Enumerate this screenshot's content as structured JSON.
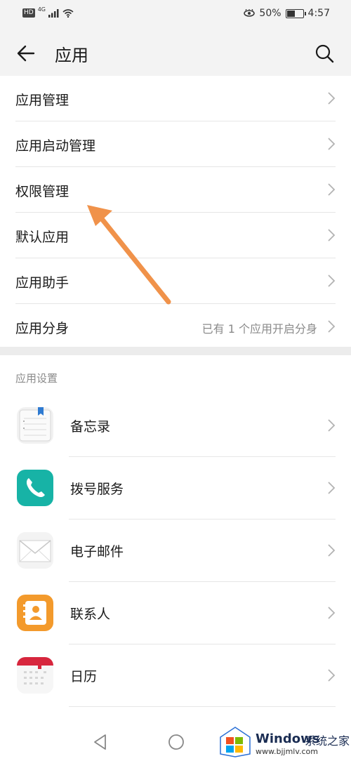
{
  "status_bar": {
    "hd_badge": "HD",
    "network_label": "4G",
    "eye_icon": "eye-comfort-icon",
    "battery_percent": "50%",
    "battery_fraction": 0.5,
    "time": "4:57"
  },
  "header": {
    "title": "应用",
    "back_icon": "back-arrow-icon",
    "search_icon": "search-icon"
  },
  "menu": {
    "items": [
      {
        "label": "应用管理",
        "value": ""
      },
      {
        "label": "应用启动管理",
        "value": ""
      },
      {
        "label": "权限管理",
        "value": ""
      },
      {
        "label": "默认应用",
        "value": ""
      },
      {
        "label": "应用助手",
        "value": ""
      },
      {
        "label": "应用分身",
        "value": "已有 1 个应用开启分身"
      }
    ]
  },
  "app_settings": {
    "section_title": "应用设置",
    "apps": [
      {
        "label": "备忘录",
        "icon": "notepad-icon",
        "color": "#f1f1f1"
      },
      {
        "label": "拨号服务",
        "icon": "phone-icon",
        "color": "#17b3a6"
      },
      {
        "label": "电子邮件",
        "icon": "mail-icon",
        "color": "#f3f3f3"
      },
      {
        "label": "联系人",
        "icon": "contacts-icon",
        "color": "#f39a2c"
      },
      {
        "label": "日历",
        "icon": "calendar-icon",
        "color": "#d7263d"
      }
    ]
  },
  "annotation": {
    "color": "#f0924a"
  },
  "nav_bar": {
    "back_icon": "nav-back-icon",
    "home_icon": "nav-home-icon"
  },
  "watermark": {
    "brand": "Windows",
    "suffix": "系统之家",
    "url": "www.bjjmlv.com"
  }
}
